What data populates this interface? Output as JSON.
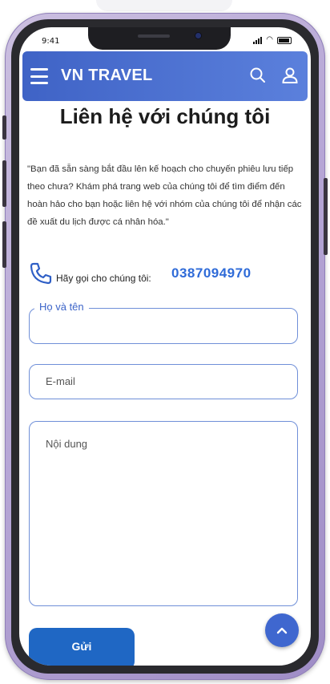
{
  "status_bar": {
    "time": "9:41"
  },
  "header": {
    "brand": "VN TRAVEL",
    "menu_icon": "hamburger-menu-icon",
    "search_icon": "search-icon",
    "account_icon": "user-icon"
  },
  "page": {
    "title": "Liên hệ với chúng tôi",
    "intro": "\"Bạn đã sẵn sàng bắt đầu lên kế hoạch cho chuyến phiêu lưu tiếp theo chưa? Khám phá trang web của chúng tôi để tìm điểm đến hoàn hảo cho bạn hoặc liên hệ với nhóm của chúng tôi để nhận các đề xuất du lịch được cá nhân hóa.\"",
    "call_label": "Hãy gọi cho chúng tôi:",
    "call_number": "0387094970"
  },
  "form": {
    "name_label": "Họ và tên",
    "name_value": "",
    "email_placeholder": "E-mail",
    "content_placeholder": "Nội dung",
    "submit_label": "Gửi"
  },
  "colors": {
    "accent": "#3f67cf",
    "link": "#2f6bd8",
    "header_start": "#3f63c6",
    "header_end": "#5b80dc",
    "button": "#1f67c4"
  }
}
